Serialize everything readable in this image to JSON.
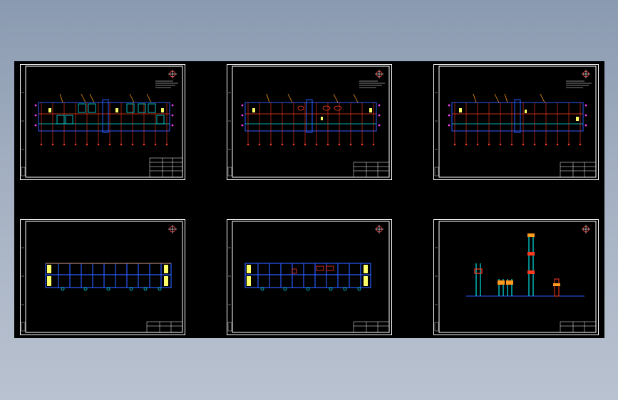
{
  "viewer": {
    "name": "cad-drawing-preview",
    "background": "#000000",
    "accent_colors": {
      "frame": "#ffffff",
      "grid_blue": "#2a5cff",
      "grid_cyan": "#00e5e5",
      "red": "#ff3a1f",
      "yellow": "#ffff66",
      "orange": "#ff9a1f",
      "magenta": "#ff40ff"
    }
  },
  "sheets": [
    {
      "id": "plan-1",
      "kind": "floor-plan",
      "variant": "full"
    },
    {
      "id": "plan-2",
      "kind": "floor-plan",
      "variant": "sparse"
    },
    {
      "id": "plan-3",
      "kind": "floor-plan",
      "variant": "minimal"
    },
    {
      "id": "elev-1",
      "kind": "elevation",
      "variant": "full"
    },
    {
      "id": "elev-2",
      "kind": "elevation",
      "variant": "partial"
    },
    {
      "id": "elev-3",
      "kind": "section-detail",
      "variant": "columns"
    }
  ]
}
